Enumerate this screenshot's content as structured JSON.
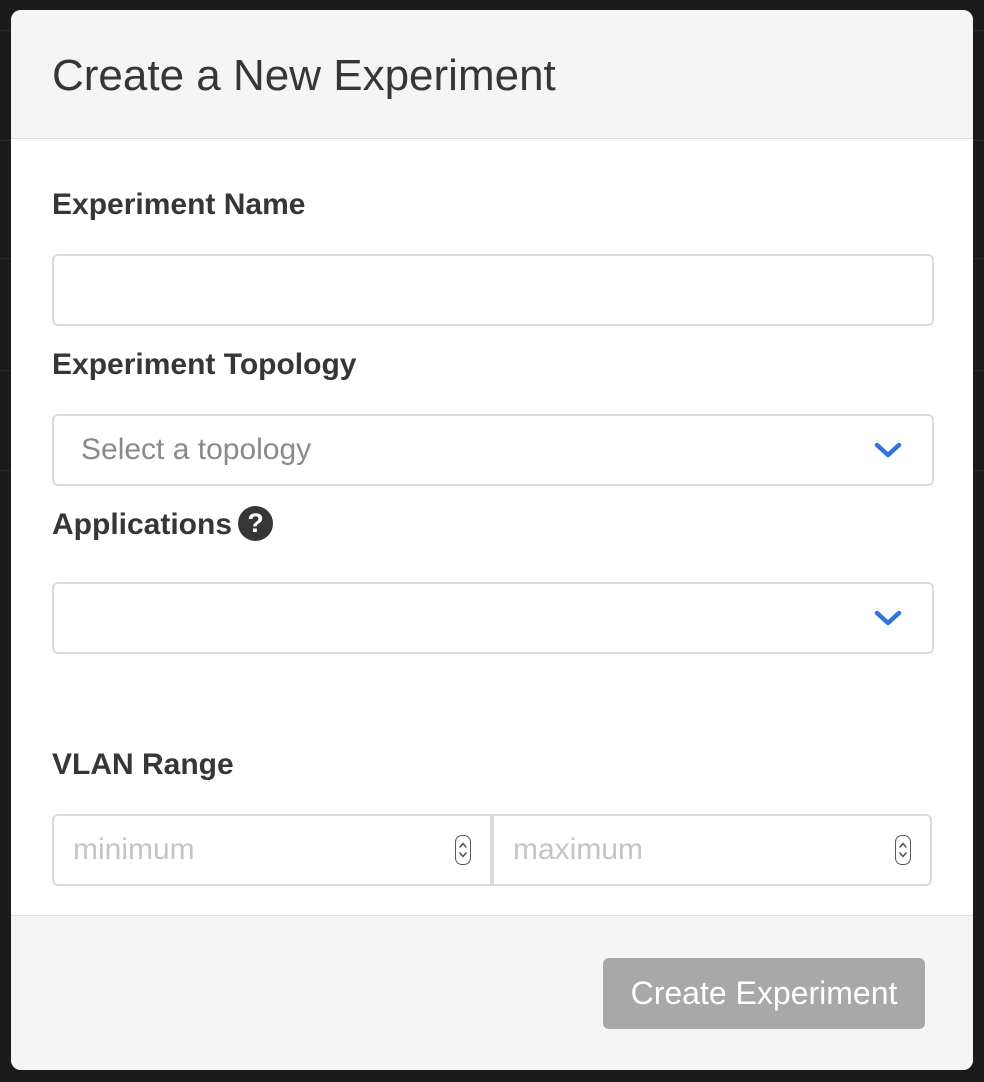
{
  "modal": {
    "title": "Create a New Experiment"
  },
  "form": {
    "name": {
      "label": "Experiment Name",
      "value": ""
    },
    "topology": {
      "label": "Experiment Topology",
      "placeholder": "Select a topology"
    },
    "applications": {
      "label": "Applications",
      "help_glyph": "?",
      "value": ""
    },
    "vlan": {
      "label": "VLAN Range",
      "min_placeholder": "minimum",
      "max_placeholder": "maximum"
    }
  },
  "footer": {
    "create_label": "Create Experiment"
  },
  "icons": {
    "dropdown": "chevron-down-icon",
    "help": "question-circle-icon",
    "spinner": "spinner-arrows-icon"
  },
  "colors": {
    "accent": "#3273dc",
    "disabled_button": "#a8a8a8",
    "header_bg": "#f5f5f5",
    "text": "#363636"
  }
}
